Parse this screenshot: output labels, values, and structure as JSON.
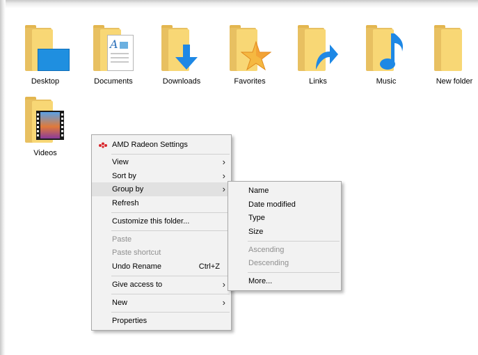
{
  "desktop_icons": [
    {
      "label": "Desktop",
      "icon": "desktop-folder-icon"
    },
    {
      "label": "Documents",
      "icon": "documents-folder-icon"
    },
    {
      "label": "Downloads",
      "icon": "downloads-folder-icon"
    },
    {
      "label": "Favorites",
      "icon": "favorites-folder-icon"
    },
    {
      "label": "Links",
      "icon": "links-folder-icon"
    },
    {
      "label": "Music",
      "icon": "music-folder-icon"
    },
    {
      "label": "New folder",
      "icon": "folder-icon"
    },
    {
      "label": "Videos",
      "icon": "videos-folder-icon"
    }
  ],
  "context_menu": {
    "amd": "AMD Radeon Settings",
    "view": "View",
    "sort_by": "Sort by",
    "group_by": "Group by",
    "refresh": "Refresh",
    "customize": "Customize this folder...",
    "paste": "Paste",
    "paste_shortcut": "Paste shortcut",
    "undo_rename": "Undo Rename",
    "undo_shortcut": "Ctrl+Z",
    "give_access": "Give access to",
    "new": "New",
    "properties": "Properties"
  },
  "group_by_submenu": {
    "name": "Name",
    "date_modified": "Date modified",
    "type": "Type",
    "size": "Size",
    "ascending": "Ascending",
    "descending": "Descending",
    "more": "More..."
  },
  "colors": {
    "folder": "#f8d775",
    "menu_bg": "#f2f2f2",
    "highlight": "#e1e1e1",
    "disabled_text": "#8f8f8f",
    "amd_red": "#d9262c",
    "accent_blue": "#1e88e5"
  }
}
